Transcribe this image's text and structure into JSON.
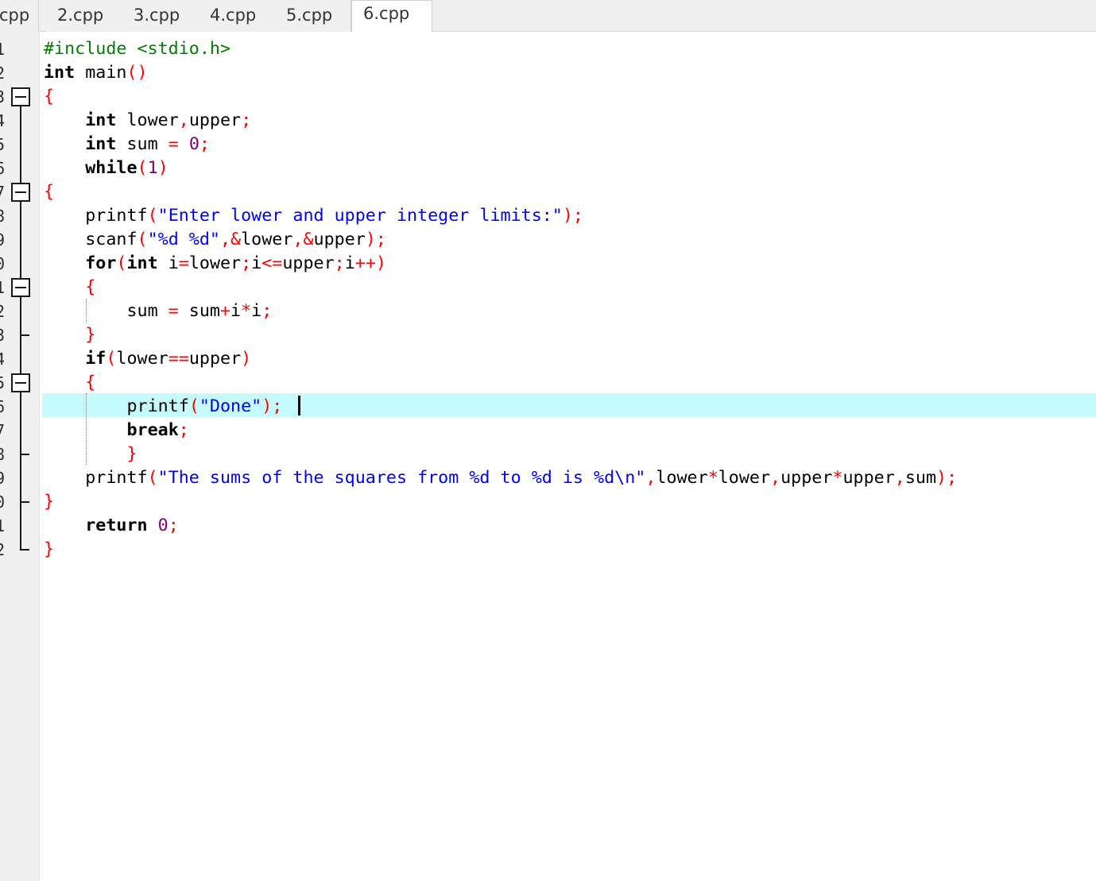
{
  "tabs": [
    {
      "label": "cpp",
      "active": false
    },
    {
      "label": "2.cpp",
      "active": false
    },
    {
      "label": "3.cpp",
      "active": false
    },
    {
      "label": "4.cpp",
      "active": false
    },
    {
      "label": "5.cpp",
      "active": false
    },
    {
      "label": "6.cpp",
      "active": true
    }
  ],
  "gutter": {
    "line_numbers": [
      "1",
      "2",
      "3",
      "4",
      "5",
      "6",
      "7",
      "8",
      "9",
      "0",
      "1",
      "2",
      "3",
      "4",
      "5",
      "6",
      "7",
      "8",
      "9",
      "0",
      "1",
      "2"
    ]
  },
  "editor": {
    "current_line": 16,
    "lines": [
      [
        {
          "t": "#include <stdio.h>",
          "c": "pp"
        }
      ],
      [
        {
          "t": "int",
          "c": "kw"
        },
        {
          "t": " main"
        },
        {
          "t": "()",
          "c": "pun"
        }
      ],
      [
        {
          "t": "{",
          "c": "pun"
        }
      ],
      [
        {
          "t": "    "
        },
        {
          "t": "int",
          "c": "kw"
        },
        {
          "t": " lower"
        },
        {
          "t": ",",
          "c": "pun"
        },
        {
          "t": "upper"
        },
        {
          "t": ";",
          "c": "pun"
        }
      ],
      [
        {
          "t": "    "
        },
        {
          "t": "int",
          "c": "kw"
        },
        {
          "t": " sum "
        },
        {
          "t": "=",
          "c": "pun"
        },
        {
          "t": " "
        },
        {
          "t": "0",
          "c": "num"
        },
        {
          "t": ";",
          "c": "pun"
        }
      ],
      [
        {
          "t": "    "
        },
        {
          "t": "while",
          "c": "kw"
        },
        {
          "t": "(",
          "c": "pun"
        },
        {
          "t": "1",
          "c": "num"
        },
        {
          "t": ")",
          "c": "pun"
        }
      ],
      [
        {
          "t": "{",
          "c": "pun"
        }
      ],
      [
        {
          "t": "    printf"
        },
        {
          "t": "(",
          "c": "pun"
        },
        {
          "t": "\"Enter lower and upper integer limits:\"",
          "c": "str"
        },
        {
          "t": ");",
          "c": "pun"
        }
      ],
      [
        {
          "t": "    scanf"
        },
        {
          "t": "(",
          "c": "pun"
        },
        {
          "t": "\"%d %d\"",
          "c": "str"
        },
        {
          "t": ",&",
          "c": "pun"
        },
        {
          "t": "lower"
        },
        {
          "t": ",&",
          "c": "pun"
        },
        {
          "t": "upper"
        },
        {
          "t": ");",
          "c": "pun"
        }
      ],
      [
        {
          "t": "    "
        },
        {
          "t": "for",
          "c": "kw"
        },
        {
          "t": "(",
          "c": "pun"
        },
        {
          "t": "int",
          "c": "kw"
        },
        {
          "t": " i"
        },
        {
          "t": "=",
          "c": "pun"
        },
        {
          "t": "lower"
        },
        {
          "t": ";",
          "c": "pun"
        },
        {
          "t": "i"
        },
        {
          "t": "<=",
          "c": "pun"
        },
        {
          "t": "upper"
        },
        {
          "t": ";",
          "c": "pun"
        },
        {
          "t": "i"
        },
        {
          "t": "++)",
          "c": "pun"
        }
      ],
      [
        {
          "t": "    "
        },
        {
          "t": "{",
          "c": "pun"
        }
      ],
      [
        {
          "t": "        sum "
        },
        {
          "t": "=",
          "c": "pun"
        },
        {
          "t": " sum"
        },
        {
          "t": "+",
          "c": "pun"
        },
        {
          "t": "i"
        },
        {
          "t": "*",
          "c": "pun"
        },
        {
          "t": "i"
        },
        {
          "t": ";",
          "c": "pun"
        }
      ],
      [
        {
          "t": "    "
        },
        {
          "t": "}",
          "c": "pun"
        }
      ],
      [
        {
          "t": "    "
        },
        {
          "t": "if",
          "c": "kw"
        },
        {
          "t": "(",
          "c": "pun"
        },
        {
          "t": "lower"
        },
        {
          "t": "==",
          "c": "pun"
        },
        {
          "t": "upper"
        },
        {
          "t": ")",
          "c": "pun"
        }
      ],
      [
        {
          "t": "    "
        },
        {
          "t": "{",
          "c": "pun"
        }
      ],
      [
        {
          "t": "        printf"
        },
        {
          "t": "(",
          "c": "pun"
        },
        {
          "t": "\"Done\"",
          "c": "str"
        },
        {
          "t": ");",
          "c": "pun"
        }
      ],
      [
        {
          "t": "        "
        },
        {
          "t": "break",
          "c": "kw"
        },
        {
          "t": ";",
          "c": "pun"
        }
      ],
      [
        {
          "t": "        "
        },
        {
          "t": "}",
          "c": "pun"
        }
      ],
      [
        {
          "t": "    printf"
        },
        {
          "t": "(",
          "c": "pun"
        },
        {
          "t": "\"The sums of the squares from %d to %d is %d\\n\"",
          "c": "str"
        },
        {
          "t": ",",
          "c": "pun"
        },
        {
          "t": "lower"
        },
        {
          "t": "*",
          "c": "pun"
        },
        {
          "t": "lower"
        },
        {
          "t": ",",
          "c": "pun"
        },
        {
          "t": "upper"
        },
        {
          "t": "*",
          "c": "pun"
        },
        {
          "t": "upper"
        },
        {
          "t": ",",
          "c": "pun"
        },
        {
          "t": "sum"
        },
        {
          "t": ");",
          "c": "pun"
        }
      ],
      [
        {
          "t": "}",
          "c": "pun"
        }
      ],
      [
        {
          "t": "    "
        },
        {
          "t": "return",
          "c": "kw"
        },
        {
          "t": " "
        },
        {
          "t": "0",
          "c": "num"
        },
        {
          "t": ";",
          "c": "pun"
        }
      ],
      [
        {
          "t": "}",
          "c": "pun"
        }
      ]
    ]
  },
  "colors": {
    "keyword": "#000000",
    "preprocessor": "#008000",
    "punctuation": "#ff0000",
    "string": "#0000ff",
    "number": "#800080",
    "current_line_highlight": "#c5fbfd"
  }
}
